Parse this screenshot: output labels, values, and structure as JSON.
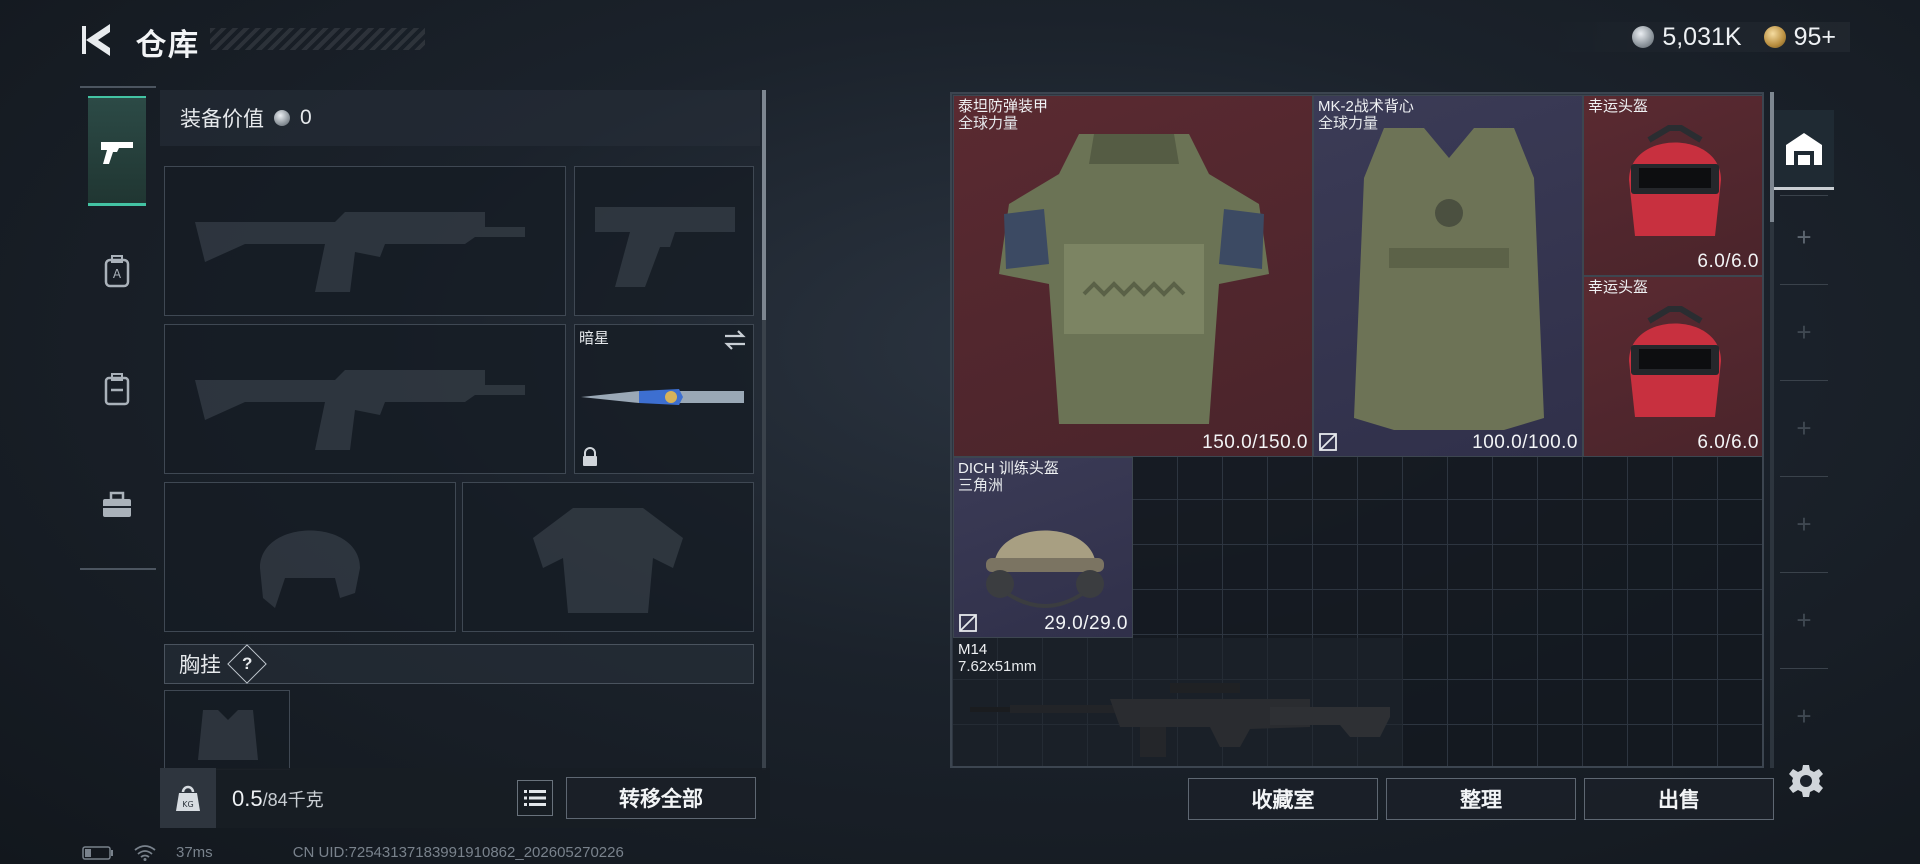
{
  "header": {
    "title": "仓库",
    "currency": [
      {
        "icon": "silver-coin-icon",
        "value": "5,031K"
      },
      {
        "icon": "gold-coin-icon",
        "value": "95+"
      }
    ]
  },
  "categories": [
    {
      "icon": "pistol-icon",
      "active": true
    },
    {
      "icon": "armor-bag-icon",
      "active": false
    },
    {
      "icon": "backpack-icon",
      "active": false
    },
    {
      "icon": "toolbox-icon",
      "active": false
    }
  ],
  "loadout": {
    "equip_value_label": "装备价值",
    "equip_value": "0",
    "melee": {
      "name": "暗星"
    },
    "chest_rig_label": "胸挂",
    "help_badge": "?"
  },
  "weight": {
    "current": "0.5",
    "max": "/84千克",
    "unit_badge": "KG"
  },
  "buttons": {
    "transfer_all": "转移全部",
    "collection": "收藏室",
    "organize": "整理",
    "sell": "出售"
  },
  "items": [
    {
      "name": "泰坦防弹装甲",
      "sub": "全球力量",
      "durability": "150.0/150.0",
      "rarity_color": "#5a2a31"
    },
    {
      "name": "MK-2战术背心",
      "sub": "全球力量",
      "durability": "100.0/100.0",
      "rarity_color": "#3b3b56"
    },
    {
      "name": "幸运头盔",
      "sub": "",
      "durability": "6.0/6.0",
      "rarity_color": "#5a2a31"
    },
    {
      "name": "幸运头盔",
      "sub": "",
      "durability": "6.0/6.0",
      "rarity_color": "#5a2a31"
    },
    {
      "name": "DICH 训练头盔",
      "sub": "三角洲",
      "durability": "29.0/29.0",
      "rarity_color": "#3b3b56"
    },
    {
      "name": "M14",
      "sub": "7.62x51mm",
      "durability": "",
      "rarity_color": "#1e242d"
    }
  ],
  "status": {
    "ping": "37ms",
    "uid": "CN UID:72543137183991910862_202605270226"
  }
}
